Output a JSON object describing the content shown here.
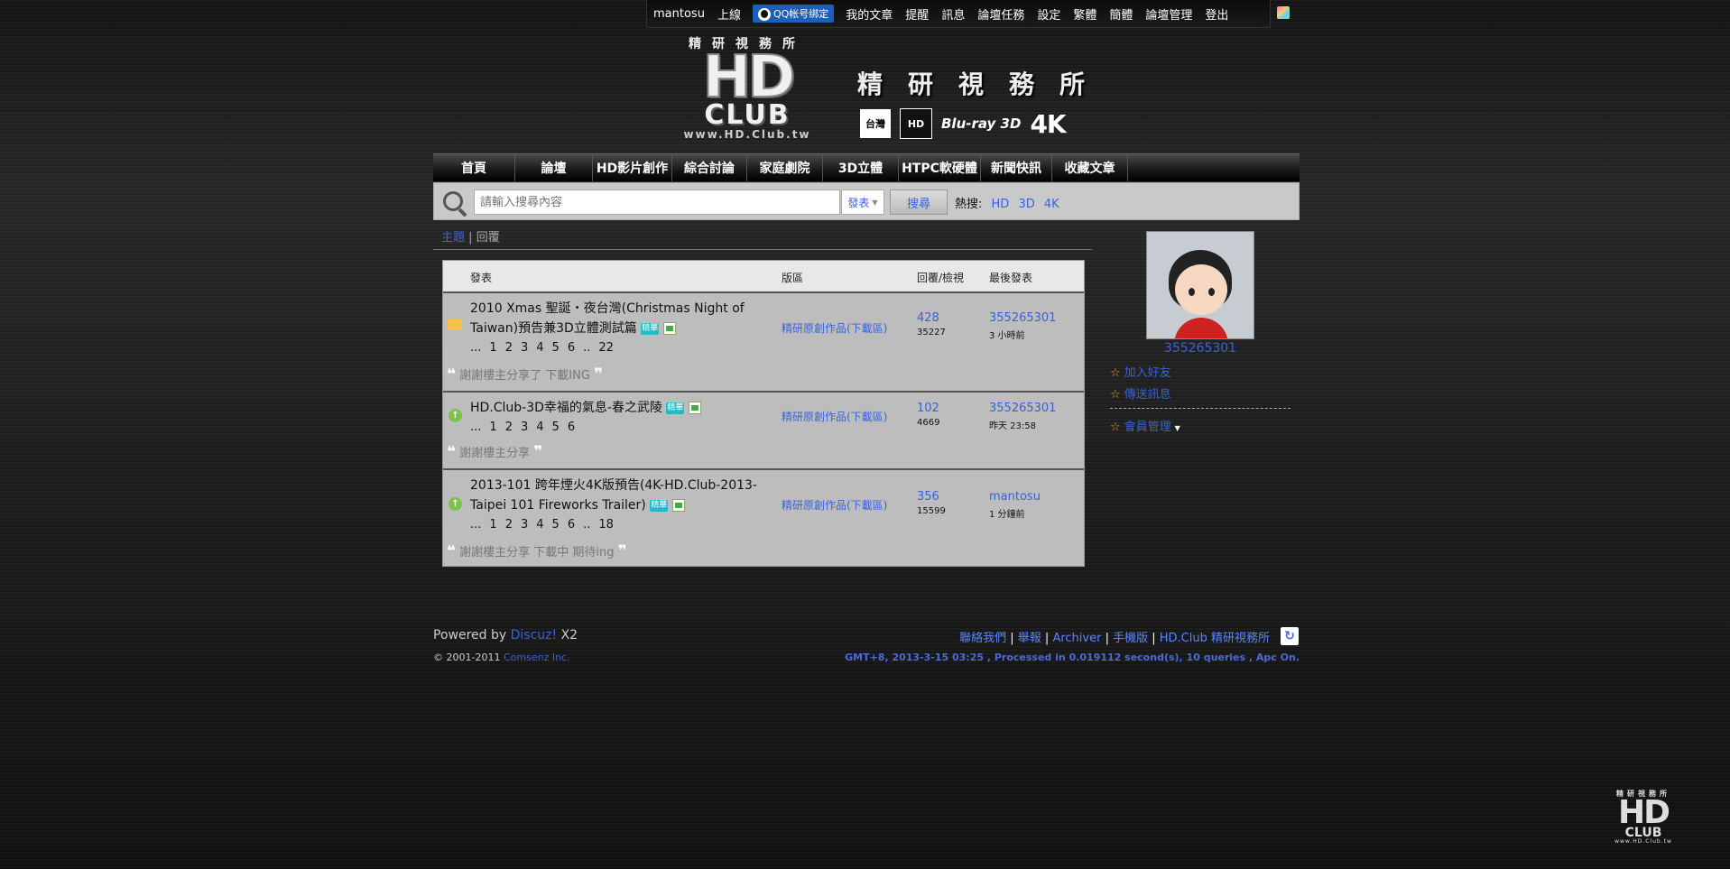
{
  "topbar": {
    "username": "mantosu",
    "online": "上線",
    "qq_bind": "QQ帐号绑定",
    "links": [
      "我的文章",
      "提醒",
      "訊息",
      "論壇任務",
      "設定",
      "繁體",
      "簡體",
      "論壇管理",
      "登出"
    ]
  },
  "logo": {
    "top_text": "精研視務所",
    "hd": "HD",
    "club": "CLUB",
    "url": "www.HD.Club.tw"
  },
  "brand_title": "精研視務所",
  "badges": {
    "b1": "台灣",
    "b2": "HD",
    "b3": "Blu-ray 3D",
    "b4": "4K"
  },
  "nav": [
    "首頁",
    "論壇",
    "HD影片創作",
    "綜合討論",
    "家庭劇院",
    "3D立體",
    "HTPC軟硬體",
    "新聞快訊",
    "收藏文章"
  ],
  "search": {
    "placeholder": "請輸入搜尋內容",
    "type": "發表",
    "button": "搜尋",
    "hot_label": "熱搜:",
    "hot_keywords": [
      "HD",
      "3D",
      "4K"
    ]
  },
  "tabs": {
    "active": "主題",
    "separator": "|",
    "other": "回覆"
  },
  "table": {
    "headers": {
      "subject": "發表",
      "forum": "版區",
      "replies_views": "回覆/檢視",
      "last_post": "最後發表"
    },
    "rows": [
      {
        "title_line1": "2010 Xmas 聖誕・夜台灣(Christmas Night of",
        "title_line2": "Taiwan)預告兼3D立體測試篇",
        "tag": "精華",
        "pages": [
          "...",
          "1",
          "2",
          "3",
          "4",
          "5",
          "6",
          "..",
          "22"
        ],
        "forum": "精研原創作品(下載區)",
        "replies": "428",
        "views": "35227",
        "last_user": "355265301",
        "last_time": "3 小時前",
        "quote": "謝謝樓主分享了 下載ING"
      },
      {
        "title_line1": "HD.Club-3D幸福的氣息-春之武陵",
        "title_line2": "",
        "tag": "精華",
        "pages": [
          "...",
          "1",
          "2",
          "3",
          "4",
          "5",
          "6"
        ],
        "forum": "精研原創作品(下載區)",
        "replies": "102",
        "views": "4669",
        "last_user": "355265301",
        "last_time": "昨天 23:58",
        "quote": "謝謝樓主分享"
      },
      {
        "title_line1": "2013-101 跨年煙火4K版預告(4K-HD.Club-2013-",
        "title_line2": "Taipei 101 Fireworks Trailer)",
        "tag": "精華",
        "pages": [
          "...",
          "1",
          "2",
          "3",
          "4",
          "5",
          "6",
          "..",
          "18"
        ],
        "forum": "精研原創作品(下載區)",
        "replies": "356",
        "views": "15599",
        "last_user": "mantosu",
        "last_time": "1 分鐘前",
        "quote": "謝謝樓主分享 下載中 期待ing"
      }
    ]
  },
  "profile": {
    "name": "355265301",
    "add_friend": "加入好友",
    "send_message": "傳送訊息",
    "member_admin": "會員管理"
  },
  "footer": {
    "powered_prefix": "Powered by",
    "discuz": "Discuz!",
    "version": "X2",
    "copyright_prefix": "© 2001-2011",
    "comsenz": "Comsenz Inc.",
    "links": [
      "聯絡我們",
      "舉報",
      "Archiver",
      "手機版",
      "HD.Club 精研視務所"
    ],
    "stats": "GMT+8, 2013-3-15 03:25 , Processed in 0.019112 second(s), 10 queries , Apc On."
  }
}
